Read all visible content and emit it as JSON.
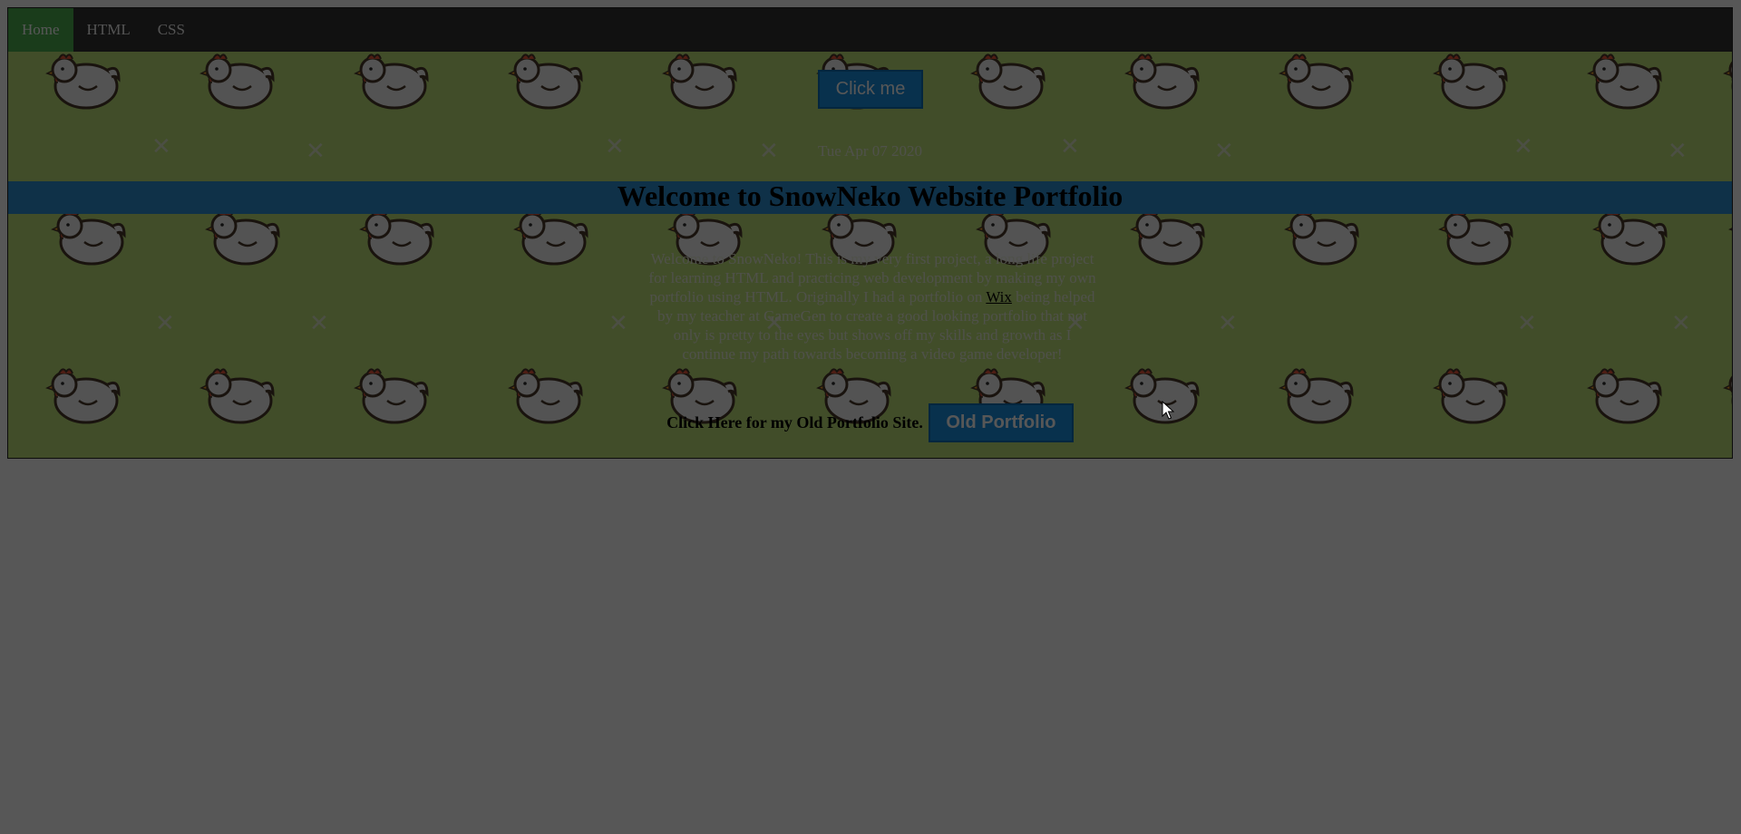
{
  "nav": {
    "items": [
      {
        "label": "Home",
        "active": true
      },
      {
        "label": "HTML",
        "active": false
      },
      {
        "label": "CSS",
        "active": false
      }
    ],
    "active_color": "#4CAF50",
    "bar_color": "#333333"
  },
  "buttons": {
    "click_me": "Click me",
    "old_portfolio": "Old Portfolio"
  },
  "date": "Tue Apr 07 2020",
  "title": "Welcome to SnowNeko Website Portfolio",
  "intro": {
    "before_link": "Welcome to SnowNeko! This is my very first project, a long life project for learning HTML and practicing web development by making my own portfolio using HTML. Originally I had a portfolio on",
    "link_text": "Wix",
    "after_link": "being helped by my teacher at GameGen to create a good looking portfolio that not only is pretty to the eyes but shows off my skills and growth as I continue my path towards becoming a video game developer!"
  },
  "old_portfolio_label": "Click Here for my Old Portfolio Site.",
  "colors": {
    "background_pattern": "#bfe07a",
    "title_band": "#2c8fd4",
    "button": "#1a8fe0",
    "modal_dim": "rgba(0,0,0,0.66)"
  },
  "icons": {
    "background_tile": "chicken-icon",
    "sparkle": "sparkle-icon",
    "cursor": "mouse-cursor-icon"
  }
}
